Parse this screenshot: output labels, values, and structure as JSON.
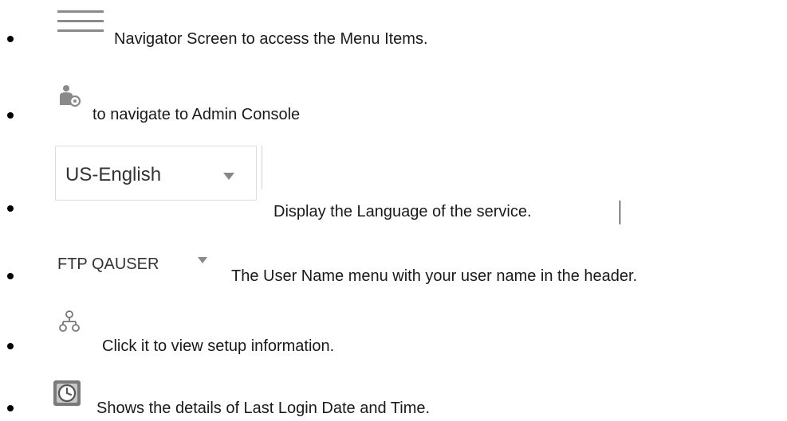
{
  "items": [
    {
      "icon": "hamburger-menu-icon",
      "text": "Navigator Screen to access the Menu Items."
    },
    {
      "icon": "admin-console-icon",
      "text": "to navigate to Admin Console"
    },
    {
      "icon": "language-select",
      "text": "Display the Language of the service."
    },
    {
      "icon": "user-name-menu",
      "text": "The User Name menu with your user name in the header."
    },
    {
      "icon": "setup-hierarchy-icon",
      "text": "Click it to view setup information."
    },
    {
      "icon": "last-login-clock-icon",
      "text": "Shows the details of Last Login Date and Time."
    }
  ],
  "language_select": {
    "value": "US-English"
  },
  "user_menu": {
    "label": "FTP QAUSER"
  }
}
